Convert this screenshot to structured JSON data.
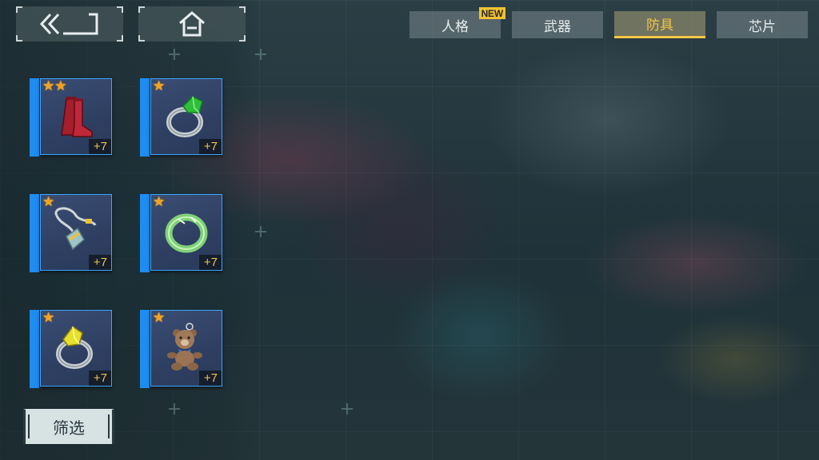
{
  "nav": {
    "back_icon": "double-chevron-left-bracket-icon",
    "home_icon": "home-icon"
  },
  "tabs": [
    {
      "label": "人格",
      "badge": "NEW",
      "active": false
    },
    {
      "label": "武器",
      "badge": "",
      "active": false
    },
    {
      "label": "防具",
      "badge": "",
      "active": true
    },
    {
      "label": "芯片",
      "badge": "",
      "active": false
    }
  ],
  "items": [
    {
      "name": "red-boots",
      "stars": 2,
      "level": "+7",
      "icon": "boots-icon"
    },
    {
      "name": "green-gem-ring",
      "stars": 1,
      "level": "+7",
      "icon": "ring-icon"
    },
    {
      "name": "pendant-necklace",
      "stars": 1,
      "level": "+7",
      "icon": "necklace-icon"
    },
    {
      "name": "green-band-ring",
      "stars": 1,
      "level": "+7",
      "icon": "band-ring-icon"
    },
    {
      "name": "yellow-gem-ring",
      "stars": 1,
      "level": "+7",
      "icon": "ring-icon"
    },
    {
      "name": "teddy-bear",
      "stars": 1,
      "level": "+7",
      "icon": "teddy-bear-icon"
    }
  ],
  "filter": {
    "label": "筛选"
  },
  "colors": {
    "accent_blue": "#1f8cf0",
    "active_tab_text": "#f3c646",
    "star": "#f2a21c",
    "level_text": "#f0c44a"
  }
}
